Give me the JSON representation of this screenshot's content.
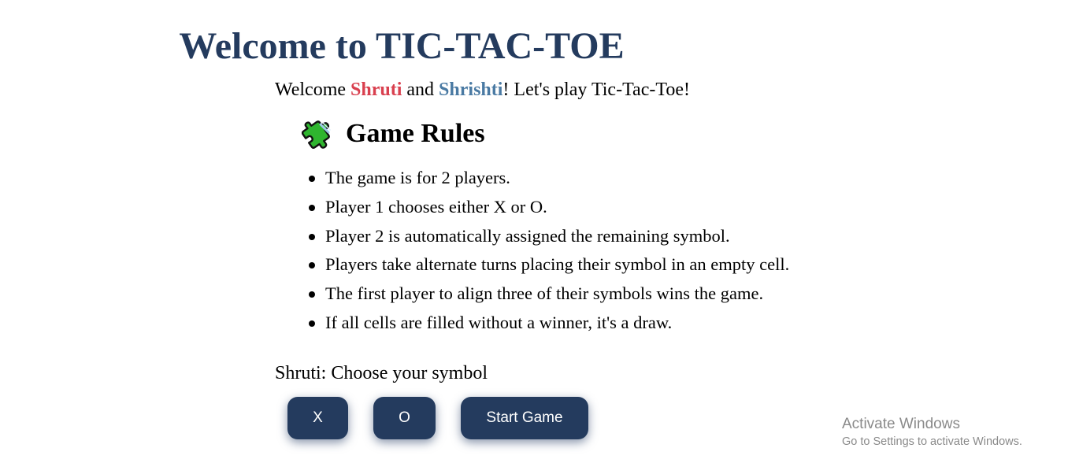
{
  "page": {
    "title": "Welcome to TIC-TAC-TOE",
    "title_color": "#243b5e"
  },
  "welcome": {
    "prefix": "Welcome ",
    "player1": "Shruti",
    "player1_color": "#d9404f",
    "middle": " and ",
    "player2": "Shrishti",
    "player2_color": "#4a7aa3",
    "suffix": "! Let's play Tic-Tac-Toe!"
  },
  "rules": {
    "icon": "puzzle-piece-icon",
    "title": "Game Rules",
    "items": [
      "The game is for 2 players.",
      "Player 1 chooses either X or O.",
      "Player 2 is automatically assigned the remaining symbol.",
      "Players take alternate turns placing their symbol in an empty cell.",
      "The first player to align three of their symbols wins the game.",
      "If all cells are filled without a winner, it's a draw."
    ]
  },
  "symbol_choice": {
    "prompt": "Shruti: Choose your symbol",
    "x_label": "X",
    "o_label": "O",
    "start_label": "Start Game",
    "button_color": "#243b5e"
  },
  "watermark": {
    "title": "Activate Windows",
    "subtitle": "Go to Settings to activate Windows."
  }
}
